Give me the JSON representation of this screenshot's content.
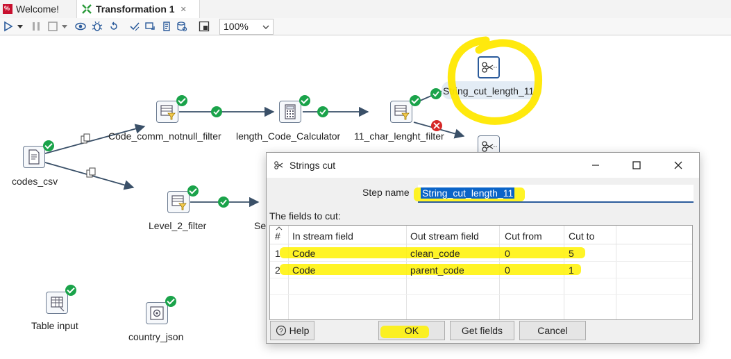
{
  "tabs": [
    {
      "label": "Welcome!",
      "active": false
    },
    {
      "label": "Transformation 1",
      "active": true
    }
  ],
  "toolbar": {
    "zoom": "100%",
    "icons": [
      "run-icon",
      "run-options-icon",
      "pause-icon",
      "stop-icon",
      "stop-options-icon",
      "preview-icon",
      "debug-icon",
      "replay-icon",
      "verify-icon",
      "impact-icon",
      "sql-icon",
      "explore-db-icon",
      "show-results-icon"
    ]
  },
  "canvas": {
    "steps": [
      {
        "name": "codes_csv",
        "icon": "csv-input-icon"
      },
      {
        "name": "Code_comm_notnull_filter",
        "icon": "filter-rows-icon"
      },
      {
        "name": "length_Code_Calculator",
        "icon": "calculator-icon"
      },
      {
        "name": "11_char_lenght_filter",
        "icon": "filter-rows-icon"
      },
      {
        "name": "String_cut_length_11",
        "icon": "strings-cut-icon"
      },
      {
        "name": "Level_2_filter",
        "icon": "filter-rows-icon"
      },
      {
        "name": "Se",
        "icon": "select-values-icon"
      },
      {
        "name": "Table input",
        "icon": "table-input-icon"
      },
      {
        "name": "country_json",
        "icon": "json-input-icon"
      }
    ]
  },
  "dialog": {
    "title": "Strings cut",
    "step_name_label": "Step name",
    "step_name_value": "String_cut_length_11",
    "fields_label": "The fields to cut:",
    "columns": [
      "#",
      "In stream field",
      "Out stream field",
      "Cut from",
      "Cut to"
    ],
    "rows": [
      {
        "num": "1",
        "in_field": "Code",
        "out_field": "clean_code",
        "cut_from": "0",
        "cut_to": "5"
      },
      {
        "num": "2",
        "in_field": "Code",
        "out_field": "parent_code",
        "cut_from": "0",
        "cut_to": "1"
      }
    ],
    "buttons": {
      "help": "Help",
      "ok": "OK",
      "get_fields": "Get fields",
      "cancel": "Cancel"
    }
  },
  "colors": {
    "highlight": "#fff200",
    "ok_status": "#1aa34a",
    "error_status": "#d62828",
    "hop": "#3a5068",
    "selection": "#0a64c8"
  }
}
